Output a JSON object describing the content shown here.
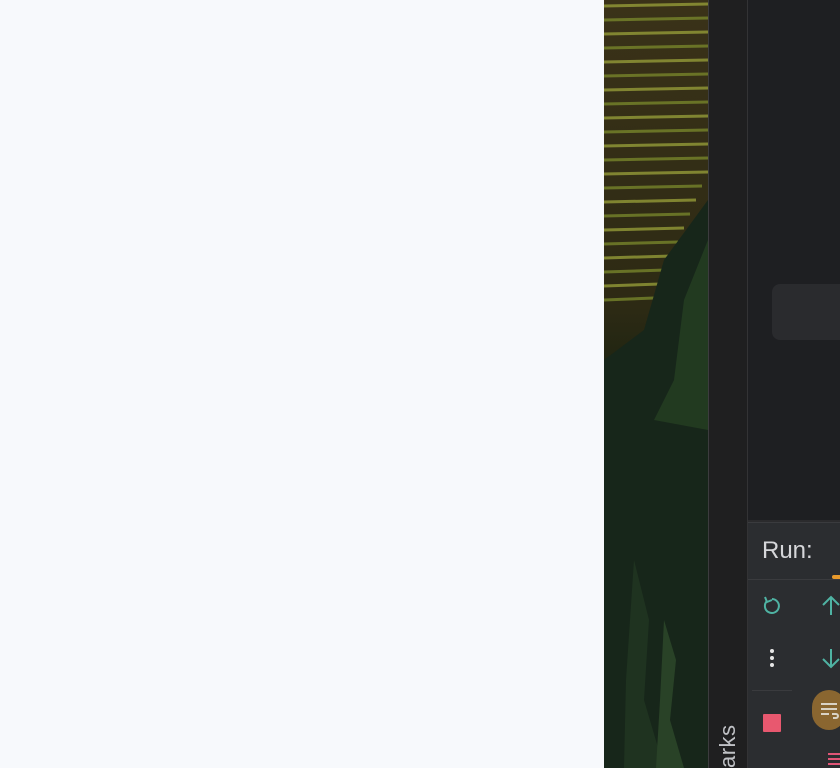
{
  "run_panel": {
    "title": "Run:"
  },
  "left_rail": {
    "label": "arks"
  },
  "icons": {
    "rerun": "rerun-icon",
    "more": "more-vertical-icon",
    "stop": "stop-icon",
    "up": "arrow-up-icon",
    "down": "arrow-down-icon",
    "soft_wrap": "soft-wrap-icon",
    "menu": "menu-icon"
  },
  "colors": {
    "rerun": "#4fb3a3",
    "stop": "#e8586f",
    "arrows": "#4fb3a3",
    "accent": "#e89a2c",
    "filter_button": "#8a6630"
  }
}
